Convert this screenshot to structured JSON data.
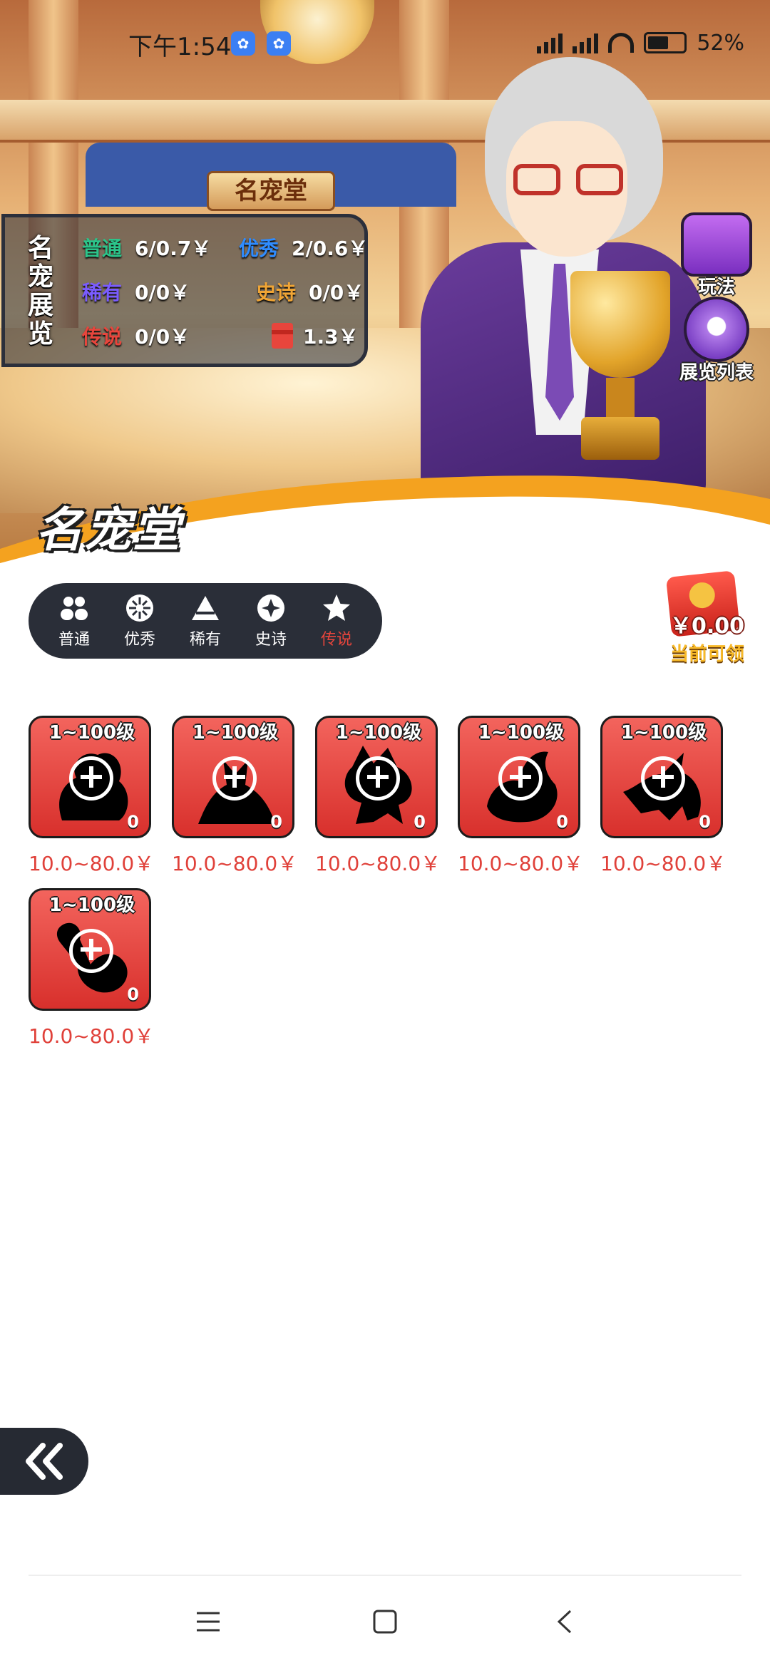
{
  "status_bar": {
    "time": "下午1:54",
    "battery": "52%",
    "app_icons": [
      "baidu-paw-icon",
      "baidu-paw-icon"
    ]
  },
  "hero": {
    "hall_sign": "名宠堂",
    "page_title": "名宠堂"
  },
  "exhibition": {
    "title": "名宠展览",
    "rows": [
      {
        "name": "普通",
        "value": "6/0.7￥",
        "color": "#2bc48a"
      },
      {
        "name": "优秀",
        "value": "2/0.6￥",
        "color": "#2f8cff"
      },
      {
        "name": "稀有",
        "value": "0/0￥",
        "color": "#7a5cff"
      },
      {
        "name": "史诗",
        "value": "0/0￥",
        "color": "#f0a535"
      },
      {
        "name": "传说",
        "value": "0/0￥",
        "color": "#e8453c"
      }
    ],
    "bonus_value": "1.3￥"
  },
  "side_buttons": {
    "rules": "玩法",
    "exhibit_list": "展览列表"
  },
  "tabs": [
    {
      "label": "普通",
      "icon": "people-icon",
      "active": false
    },
    {
      "label": "优秀",
      "icon": "burst-icon",
      "active": false
    },
    {
      "label": "稀有",
      "icon": "triangle-icon",
      "active": false
    },
    {
      "label": "史诗",
      "icon": "sparkle-icon",
      "active": false
    },
    {
      "label": "传说",
      "icon": "star-icon",
      "active": true
    }
  ],
  "claimable": {
    "amount": "￥0.00",
    "label": "当前可领"
  },
  "pets": [
    {
      "level": "1~100级",
      "count": "0",
      "price": "10.0~80.0￥"
    },
    {
      "level": "1~100级",
      "count": "0",
      "price": "10.0~80.0￥"
    },
    {
      "level": "1~100级",
      "count": "0",
      "price": "10.0~80.0￥"
    },
    {
      "level": "1~100级",
      "count": "0",
      "price": "10.0~80.0￥"
    },
    {
      "level": "1~100级",
      "count": "0",
      "price": "10.0~80.0￥"
    },
    {
      "level": "1~100级",
      "count": "0",
      "price": "10.0~80.0￥"
    }
  ],
  "colors": {
    "accent_red": "#e8453c",
    "dark_panel": "#2a2e38",
    "price_red": "#e0413a",
    "gold": "#f7b928"
  }
}
